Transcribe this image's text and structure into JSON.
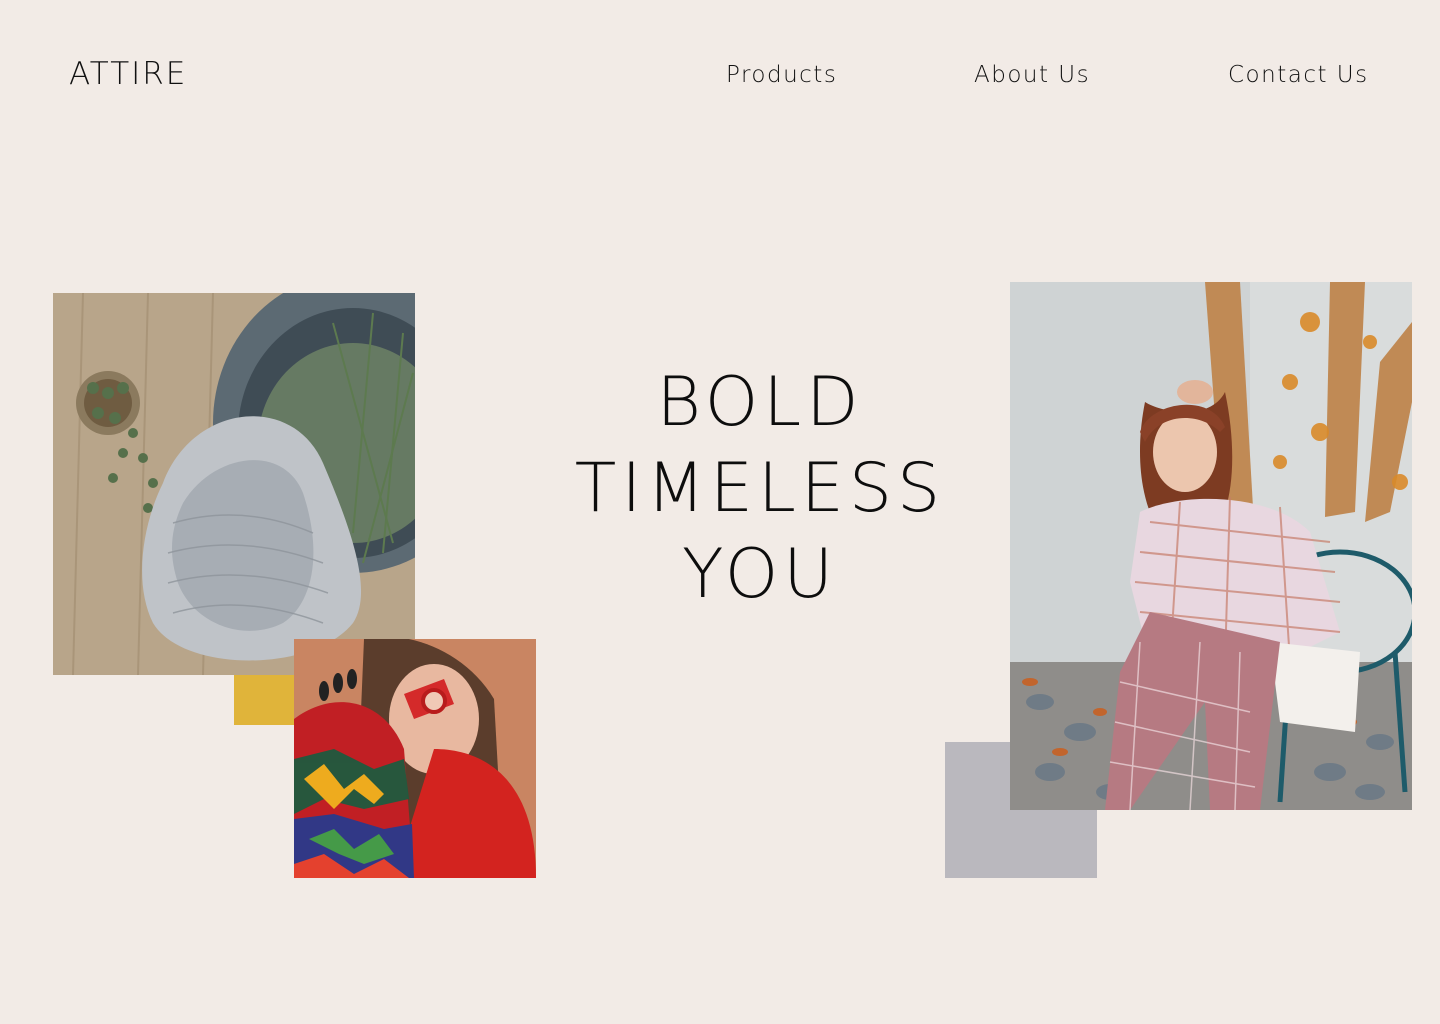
{
  "brand": {
    "name": "ATTIRE"
  },
  "nav": {
    "products": "Products",
    "about": "About Us",
    "contact": "Contact Us"
  },
  "hero": {
    "line1": "BOLD",
    "line2": "TIMELESS",
    "line3": "YOU"
  },
  "colors": {
    "background": "#f2ebe6",
    "accent_yellow": "#e0b43a",
    "accent_gray": "#bab8be",
    "text": "#111111"
  },
  "images": {
    "knit": "knit-sweater-photo",
    "red": "red-sweater-portrait-photo",
    "plaid": "plaid-shirt-portrait-photo"
  }
}
